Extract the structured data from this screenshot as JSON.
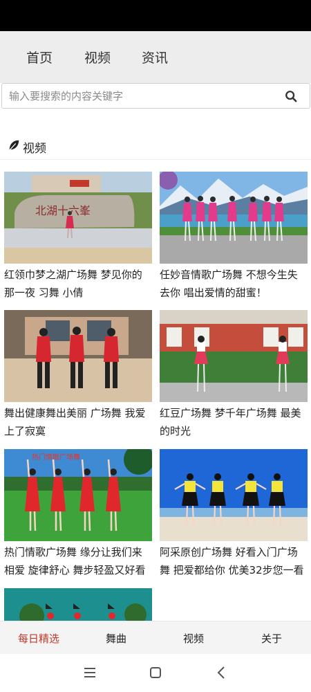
{
  "nav": {
    "items": [
      {
        "label": "首页"
      },
      {
        "label": "视频"
      },
      {
        "label": "资讯"
      }
    ]
  },
  "search": {
    "placeholder": "输入要搜索的内容关键字",
    "value": "",
    "icon": "search-icon"
  },
  "section": {
    "title": "视频",
    "icon": "leaf-icon"
  },
  "videos": [
    {
      "title": "红领巾梦之湖广场舞 梦见你的那一夜 习舞 小倩",
      "thumbnail": "dancer-in-front-of-stone-sign"
    },
    {
      "title": "任妙音情歌广场舞 不想今生失去你 唱出爱情的甜蜜！",
      "thumbnail": "dancers-by-mountain-lake"
    },
    {
      "title": "舞出健康舞出美丽 广场舞 我爱上了寂寞",
      "thumbnail": "three-dancers-in-red"
    },
    {
      "title": "红豆广场舞 梦千年广场舞 最美的时光",
      "thumbnail": "two-dancers-by-red-building"
    },
    {
      "title": "热门情歌广场舞 缘分让我们来相爱 旋律舒心 舞步轻盈又好看",
      "thumbnail": "dancers-in-red-dresses-on-grass"
    },
    {
      "title": "阿采原创广场舞 好看入门广场舞 把爱都给你 优美32步您一看",
      "thumbnail": "dancers-in-yellow-on-beach"
    },
    {
      "title": "",
      "thumbnail": "dancers-with-hats-teal"
    }
  ],
  "tabs": [
    {
      "label": "每日精选",
      "active": true
    },
    {
      "label": "舞曲",
      "active": false
    },
    {
      "label": "视频",
      "active": false
    },
    {
      "label": "关于",
      "active": false
    }
  ],
  "colors": {
    "status_bar": "#000000",
    "nav_bg": "#ededed",
    "active_tab": "#c0392b",
    "tab_bar_bg": "#f4f4f4"
  }
}
